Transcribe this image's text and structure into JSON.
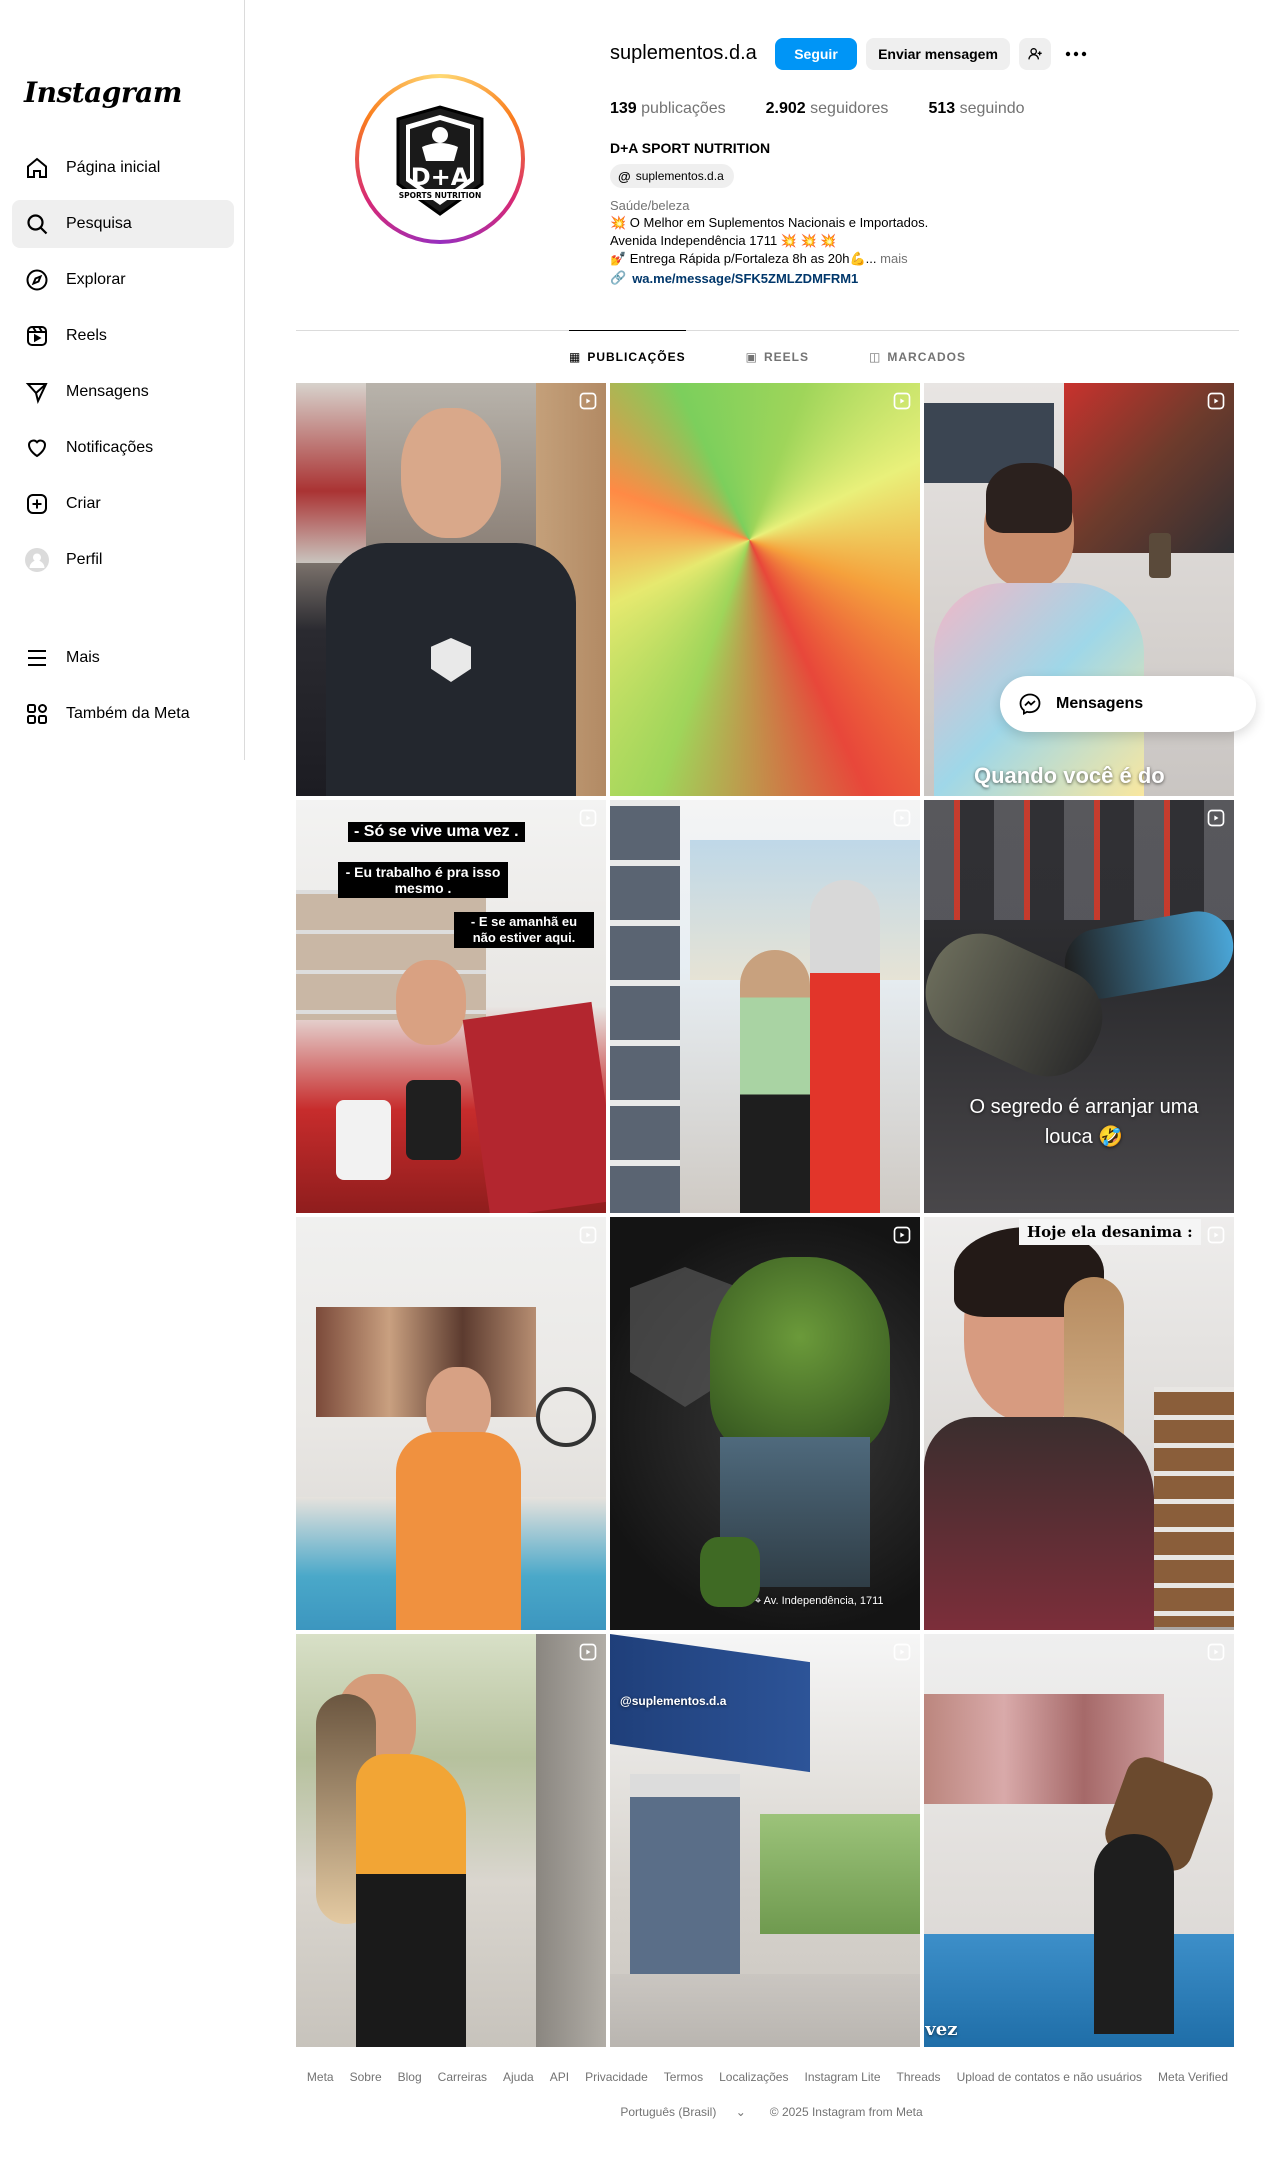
{
  "sidebar": {
    "logo": "Instagram",
    "items": [
      {
        "label": "Página inicial",
        "icon": "home-icon"
      },
      {
        "label": "Pesquisa",
        "icon": "search-icon"
      },
      {
        "label": "Explorar",
        "icon": "compass-icon"
      },
      {
        "label": "Reels",
        "icon": "reels-icon"
      },
      {
        "label": "Mensagens",
        "icon": "messenger-icon"
      },
      {
        "label": "Notificações",
        "icon": "heart-icon"
      },
      {
        "label": "Criar",
        "icon": "plus-square-icon"
      },
      {
        "label": "Perfil",
        "icon": "profile-avatar"
      }
    ],
    "bottom": [
      {
        "label": "Mais",
        "icon": "menu-icon"
      },
      {
        "label": "Também da Meta",
        "icon": "meta-apps-icon"
      }
    ]
  },
  "profile": {
    "username": "suplementos.d.a",
    "follow_label": "Seguir",
    "message_label": "Enviar mensagem",
    "stats": {
      "posts_count": "139",
      "posts_label": "publicações",
      "followers_count": "2.902",
      "followers_label": "seguidores",
      "following_count": "513",
      "following_label": "seguindo"
    },
    "full_name": "D+A SPORT NUTRITION",
    "threads_handle": "suplementos.d.a",
    "category": "Saúde/beleza",
    "bio_line1": "💥 O Melhor em Suplementos Nacionais e Importados.",
    "bio_line2": "Avenida Independência 1711 💥 💥 💥",
    "bio_line3": "💅 Entrega Rápida p/Fortaleza 8h as 20h💪...",
    "bio_more": "mais",
    "link": "wa.me/message/SFK5ZMLZDMFRM1",
    "logo_text": "D+A",
    "logo_sub": "SPORTS NUTRITION"
  },
  "tabs": [
    {
      "label": "PUBLICAÇÕES",
      "icon": "grid-icon"
    },
    {
      "label": "REELS",
      "icon": "reels-tab-icon"
    },
    {
      "label": "MARCADOS",
      "icon": "tagged-icon"
    }
  ],
  "posts": {
    "p3_caption": "Quando você é do",
    "p4_tag1": "- Só se vive uma vez .",
    "p4_tag2": "- Eu trabalho é pra isso mesmo .",
    "p4_tag3": "- E se amanhã eu não estiver aqui.",
    "p6_caption": "O segredo é arranjar uma louca 🤣",
    "p8_location": "Av. Independência, 1711",
    "p9_tag": "Hoje ela desanima :",
    "p11_caption": "@suplementos.d.a",
    "p12_caption": "Indo pela milésima vez"
  },
  "messages_pill": "Mensagens",
  "footer": {
    "links": [
      "Meta",
      "Sobre",
      "Blog",
      "Carreiras",
      "Ajuda",
      "API",
      "Privacidade",
      "Termos",
      "Localizações",
      "Instagram Lite",
      "Threads",
      "Upload de contatos e não usuários",
      "Meta Verified"
    ],
    "language": "Português (Brasil)",
    "copyright": "© 2025 Instagram from Meta"
  },
  "colors": {
    "follow": "#0095f6",
    "link": "#00376b",
    "muted": "#737373"
  }
}
